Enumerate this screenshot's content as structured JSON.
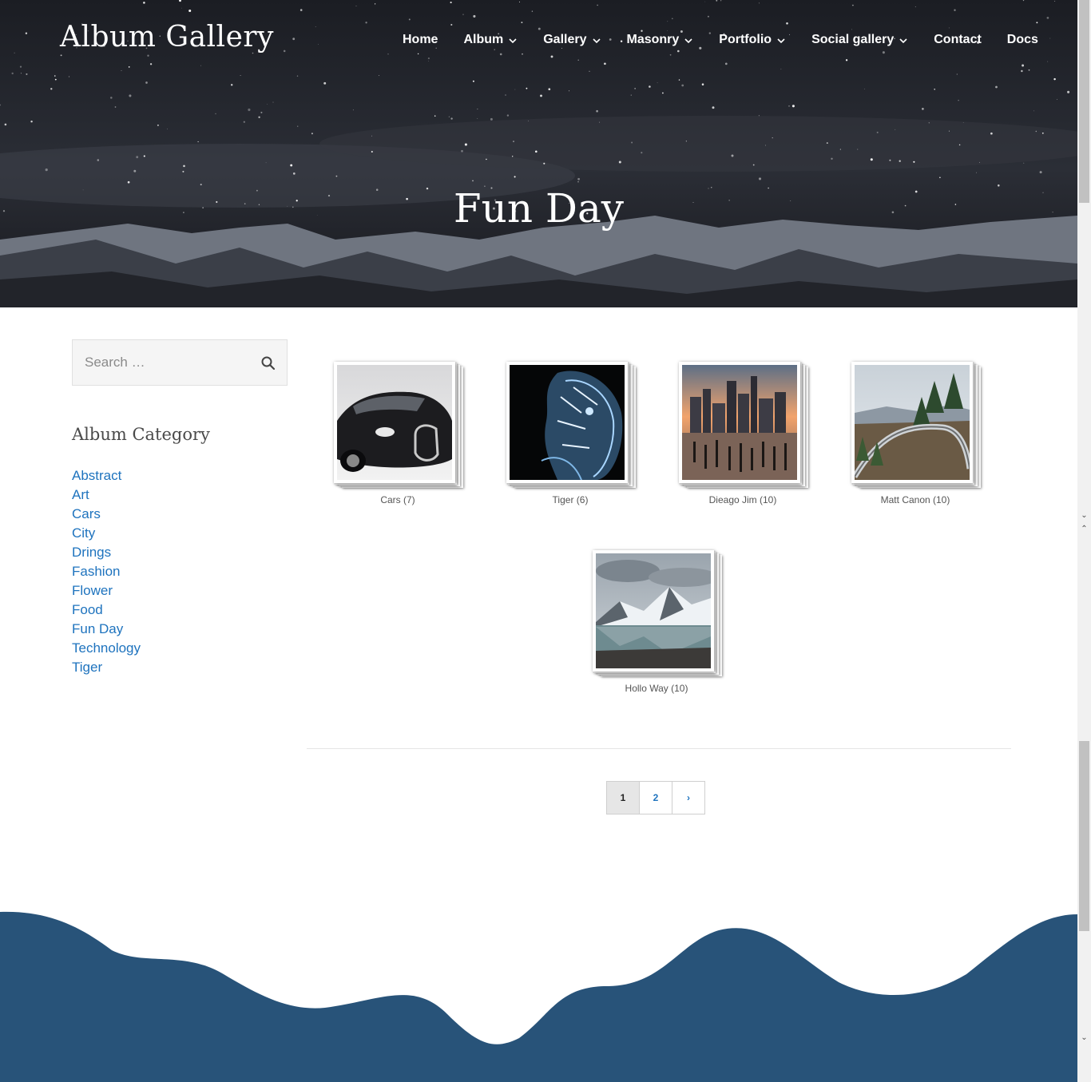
{
  "site": {
    "title": "Album Gallery"
  },
  "nav": [
    {
      "label": "Home",
      "dropdown": false
    },
    {
      "label": "Album",
      "dropdown": true
    },
    {
      "label": "Gallery",
      "dropdown": true
    },
    {
      "label": "Masonry",
      "dropdown": true
    },
    {
      "label": "Portfolio",
      "dropdown": true
    },
    {
      "label": "Social gallery",
      "dropdown": true
    },
    {
      "label": "Contact",
      "dropdown": false
    },
    {
      "label": "Docs",
      "dropdown": false
    }
  ],
  "hero": {
    "title": "Fun Day"
  },
  "sidebar": {
    "search": {
      "placeholder": "Search …"
    },
    "heading": "Album Category",
    "categories": [
      "Abstract",
      "Art",
      "Cars",
      "City",
      "Drings",
      "Fashion",
      "Flower",
      "Food",
      "Fun Day",
      "Technology",
      "Tiger"
    ]
  },
  "albums": [
    {
      "caption": "Cars (7)",
      "image": "black-sports-car"
    },
    {
      "caption": "Tiger (6)",
      "image": "glowing-tiger"
    },
    {
      "caption": "Dieago Jim (10)",
      "image": "city-skyline-sunset"
    },
    {
      "caption": "Matt Canon (10)",
      "image": "mountain-road-viaduct"
    },
    {
      "caption": "Hollo Way (10)",
      "image": "snowy-mountain-lake"
    }
  ],
  "pagination": {
    "pages": [
      "1",
      "2"
    ],
    "next": "›",
    "current": "1"
  },
  "colors": {
    "link": "#1e73be",
    "footer": "#285379",
    "hero_bg": "#1a1c22"
  }
}
